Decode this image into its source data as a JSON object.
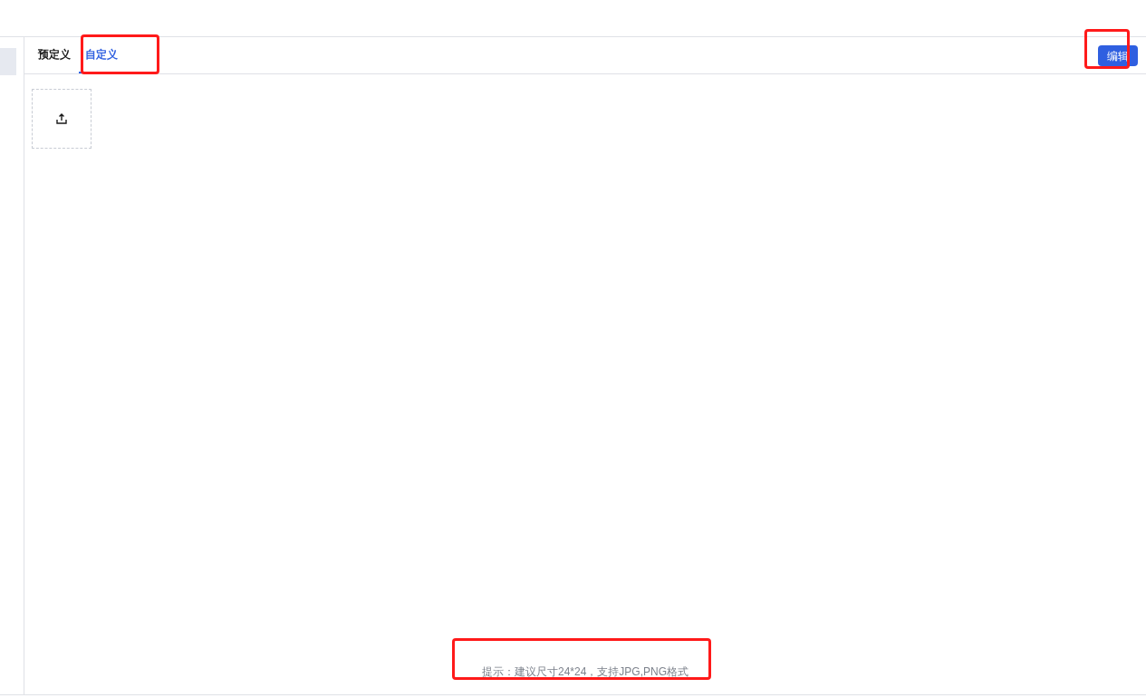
{
  "tabs": [
    {
      "label": "预定义",
      "selected": false,
      "highlighted": false
    },
    {
      "label": "自定义",
      "selected": true,
      "highlighted": true
    }
  ],
  "edit_button": {
    "label": "编辑",
    "highlighted": true
  },
  "hint": {
    "text": "提示：建议尺寸24*24，支持JPG,PNG格式",
    "highlighted": true
  }
}
